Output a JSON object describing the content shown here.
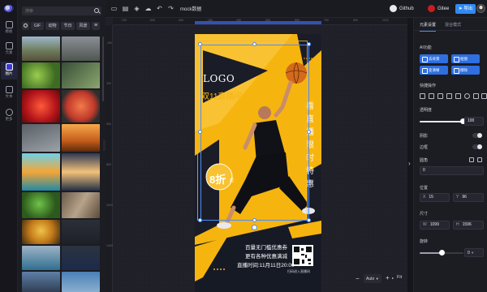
{
  "search": {
    "placeholder": "搜索"
  },
  "rail": [
    {
      "label": "模板"
    },
    {
      "label": "元素"
    },
    {
      "label": "图片"
    },
    {
      "label": "文本"
    },
    {
      "label": "更多"
    }
  ],
  "filters": [
    "GIF",
    "动物",
    "节日",
    "风景"
  ],
  "topbar": {
    "doc_name": "mock数据",
    "github_label": "Github",
    "gitee_label": "Gitee",
    "export_label": "导出"
  },
  "poster": {
    "logo": "LOGO",
    "headline": "双11直播间>>",
    "side_text": "看直播限时特惠",
    "badge_big": "8折",
    "badge_small": "起",
    "line1": "百量无门槛优惠券",
    "line2": "更有各种优惠满减",
    "line3": "直播时间:11月11日20:00",
    "qr_caption": "扫码进入直播间"
  },
  "zoom": {
    "value": "Auto",
    "minus": "−",
    "plus": "+",
    "fit": "Fit"
  },
  "right_panel": {
    "tabs": [
      "元素设置",
      "混合模式"
    ],
    "ai_title": "AI功能",
    "ai_buttons": [
      "去背景",
      "抠图",
      "变清晰",
      "擦除"
    ],
    "quick_title": "快捷操作",
    "opacity_label": "透明度",
    "opacity_value": "100",
    "opacity_fraction": 1.0,
    "shadow_label": "阴影",
    "stroke_label": "边框",
    "radius_label": "圆角",
    "radius_value": "0",
    "position_label": "位置",
    "x_label": "X",
    "x_value": "15",
    "y_label": "Y",
    "y_value": "96",
    "size_label": "尺寸",
    "w_label": "W",
    "w_value": "1099",
    "h_label": "H",
    "h_value": "1596",
    "rotate_label": "旋转",
    "rotate_value": "0"
  },
  "colors": {
    "accent": "#2f8bf2",
    "poster_yellow": "#f6b40f",
    "poster_dark": "#161a25"
  }
}
